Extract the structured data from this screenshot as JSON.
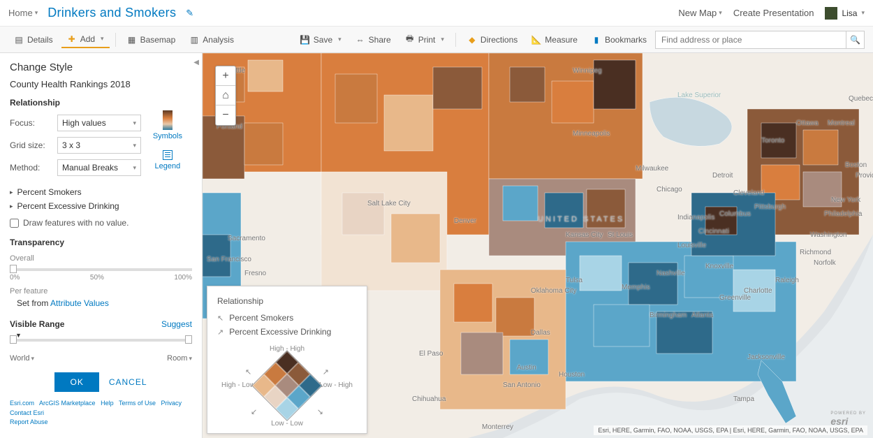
{
  "header": {
    "home": "Home",
    "title": "Drinkers and Smokers",
    "new_map": "New Map",
    "create_presentation": "Create Presentation",
    "user": "Lisa"
  },
  "toolbar": {
    "details": "Details",
    "add": "Add",
    "basemap": "Basemap",
    "analysis": "Analysis",
    "save": "Save",
    "share": "Share",
    "print": "Print",
    "directions": "Directions",
    "measure": "Measure",
    "bookmarks": "Bookmarks",
    "search_placeholder": "Find address or place"
  },
  "panel": {
    "title": "Change Style",
    "layer": "County Health Rankings 2018",
    "section": "Relationship",
    "focus_label": "Focus:",
    "focus_value": "High values",
    "grid_label": "Grid size:",
    "grid_value": "3 x 3",
    "method_label": "Method:",
    "method_value": "Manual Breaks",
    "symbols": "Symbols",
    "legend": "Legend",
    "attr1": "Percent Smokers",
    "attr2": "Percent Excessive Drinking",
    "draw_no_value": "Draw features with no value.",
    "transparency": "Transparency",
    "overall": "Overall",
    "t0": "0%",
    "t50": "50%",
    "t100": "100%",
    "per_feature": "Per feature",
    "set_from": "Set from ",
    "attr_values": "Attribute Values",
    "visible_range": "Visible Range",
    "suggest": "Suggest",
    "world": "World",
    "room": "Room",
    "ok": "OK",
    "cancel": "CANCEL"
  },
  "footer": {
    "l1": "Esri.com",
    "l2": "ArcGIS Marketplace",
    "l3": "Help",
    "l4": "Terms of Use",
    "l5": "Privacy",
    "l6": "Contact Esri",
    "l7": "Report Abuse"
  },
  "legend_card": {
    "title": "Relationship",
    "row1": "Percent Smokers",
    "row2": "Percent Excessive Drinking",
    "hh": "High - High",
    "ll": "Low - Low",
    "hl": "High - Low",
    "lh": "Low - High"
  },
  "map": {
    "attribution": "Esri, HERE, Garmin, FAO, NOAA, USGS, EPA | Esri, HERE, Garmin, FAO, NOAA, USGS, EPA",
    "powered_by": "POWERED BY",
    "logo": "esri",
    "country_label": "UNITED STATES",
    "labels": {
      "seattle": "Seattle",
      "portland": "Portland",
      "sanfrancisco": "San Francisco",
      "sacramento": "Sacramento",
      "fresno": "Fresno",
      "saltlake": "Salt Lake City",
      "denver": "Denver",
      "minneapolis": "Minneapolis",
      "chicago": "Chicago",
      "milwaukee": "Milwaukee",
      "detroit": "Detroit",
      "toronto": "Toronto",
      "ottawa": "Ottawa",
      "montreal": "Montreal",
      "quebec": "Quebec",
      "boston": "Boston",
      "newyork": "New York",
      "philadelphia": "Philadelphia",
      "washington": "Washington",
      "richmond": "Richmond",
      "norfolk": "Norfolk",
      "pittsburgh": "Pittsburgh",
      "cleveland": "Cleveland",
      "columbus": "Columbus",
      "indianapolis": "Indianapolis",
      "cincinnati": "Cincinnati",
      "louisville": "Louisville",
      "nashville": "Nashville",
      "knoxville": "Knoxville",
      "memphis": "Memphis",
      "stlouis": "St Louis",
      "kansascity": "Kansas City",
      "oklahomacity": "Oklahoma City",
      "tulsa": "Tulsa",
      "dallas": "Dallas",
      "austin": "Austin",
      "sanantonio": "San Antonio",
      "houston": "Houston",
      "elpaso": "El Paso",
      "chihuahua": "Chihuahua",
      "monterrey": "Monterrey",
      "atlanta": "Atlanta",
      "birmingham": "Birmingham",
      "jacksonville": "Jacksonville",
      "tampa": "Tampa",
      "charlotte": "Charlotte",
      "raleigh": "Raleigh",
      "greenville": "Greenville",
      "providence": "Providence",
      "winnipeg": "Winnipeg",
      "lakesuperior": "Lake Superior"
    },
    "colors": {
      "hh": "#4a2f22",
      "hm": "#8b5a3a",
      "hl": "#2e6a8a",
      "mh": "#c97a3f",
      "mm": "#a98b7e",
      "ml": "#5ba6c9",
      "lh": "#e8b88a",
      "lm": "#e8d4c4",
      "ll": "#a8d4e6"
    }
  }
}
